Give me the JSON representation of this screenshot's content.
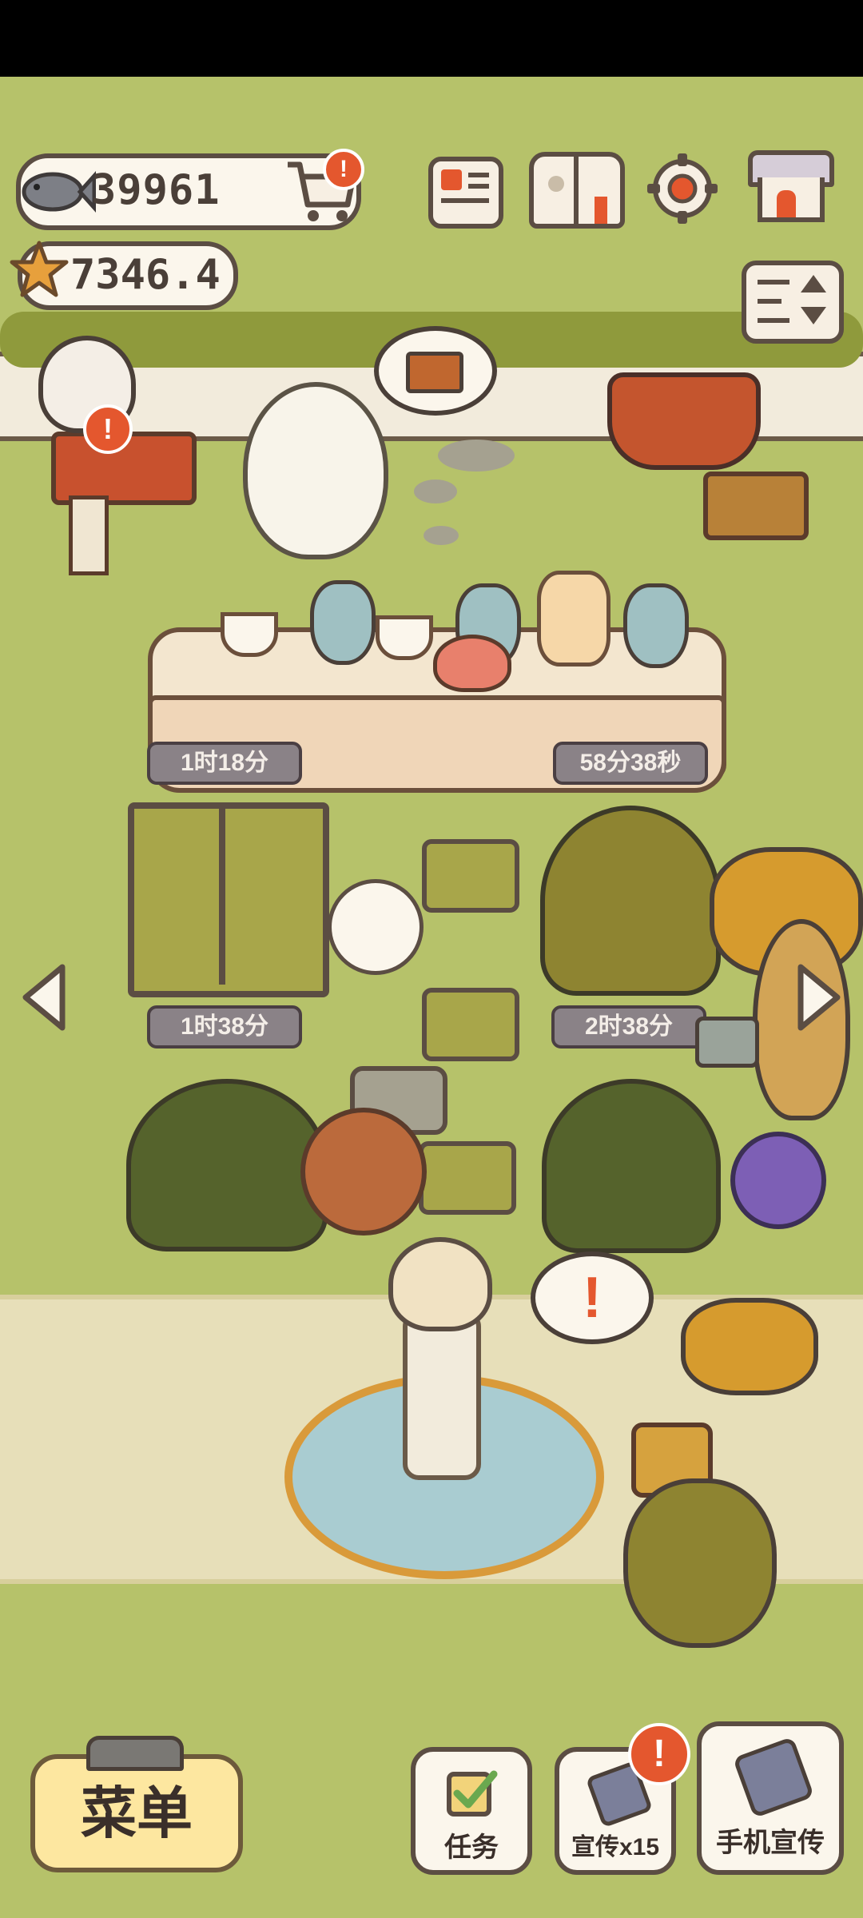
{
  "status_bar": {
    "background": "#000000"
  },
  "currency": {
    "fish": "39961",
    "stars": "7346.4"
  },
  "top_icons": [
    "shopping-cart-icon",
    "newspaper-icon",
    "paw-book-icon",
    "gear-icon",
    "shop-icon"
  ],
  "cart_badge": "!",
  "speech_bubbles": {
    "owl": "briefcase-icon",
    "fountain": "!"
  },
  "timers": {
    "table_left": "1时18分",
    "table_right": "58分38秒",
    "greenhouse": "1时38分",
    "bush": "2时38分"
  },
  "bottom_bar": {
    "menu_label": "菜单",
    "task_label": "任务",
    "promo_label": "宣传x15",
    "phone_promo_label": "手机宣传",
    "promo_badge": "!"
  },
  "colors": {
    "grass": "#b6c26a",
    "path": "#e7dfb9",
    "outline": "#5b4d43",
    "badge": "#e4572e",
    "menu_button": "#fde7a0"
  }
}
